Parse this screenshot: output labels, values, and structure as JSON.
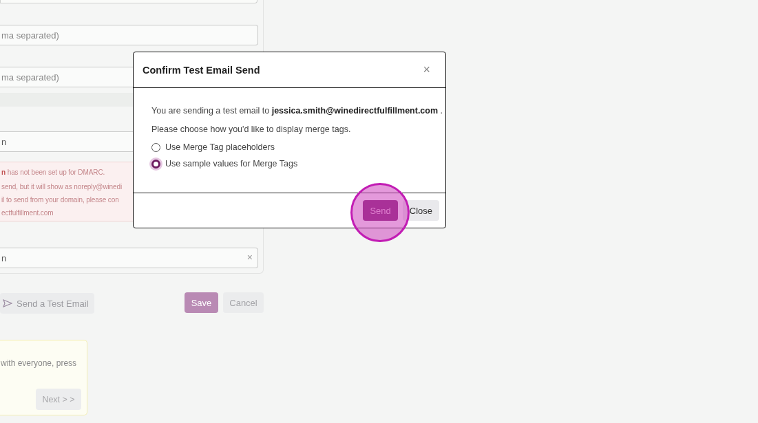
{
  "form": {
    "fields": [
      {
        "placeholder": "ma separated)"
      },
      {
        "placeholder": "ma separated)"
      },
      {
        "value": "n"
      },
      {
        "value": "n",
        "clear": "×"
      }
    ],
    "alert": {
      "lines": [
        "**n** has not been set up for DMARC.",
        "send, but it will show as noreply@winedi",
        "il to send from your domain, please con",
        "ectfulfillment.com"
      ]
    }
  },
  "actions": {
    "test_email": "Send a Test Email",
    "save": "Save",
    "cancel": "Cancel"
  },
  "tip": {
    "text": "with everyone, press",
    "next": "Next > >"
  },
  "modal": {
    "title": "Confirm Test Email Send",
    "close": "×",
    "message": "You are sending a test email to **jessica.smith@winedirectfulfillment.com** .",
    "prompt": "Please choose how you'd like to display merge tags.",
    "options": [
      {
        "label": "Use Merge Tag placeholders",
        "selected": false
      },
      {
        "label": "Use sample values for Merge Tags",
        "selected": true
      }
    ],
    "buttons": [
      {
        "label": "Send",
        "kind": "primary"
      },
      {
        "label": "Close",
        "kind": "secondary"
      }
    ]
  }
}
